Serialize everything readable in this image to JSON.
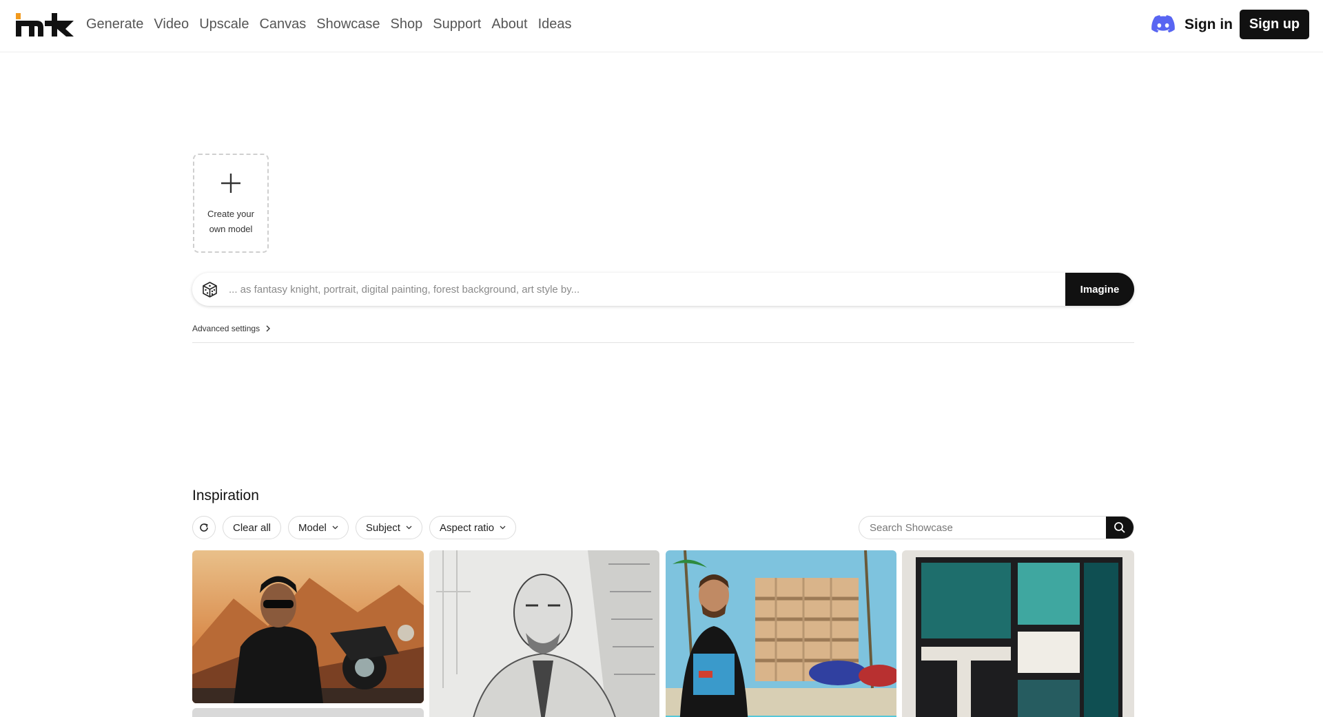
{
  "header": {
    "logo_alt": "mk",
    "nav": [
      "Generate",
      "Video",
      "Upscale",
      "Canvas",
      "Showcase",
      "Shop",
      "Support",
      "About",
      "Ideas"
    ],
    "discord_icon": "discord-icon",
    "sign_in": "Sign in",
    "sign_up": "Sign up"
  },
  "create_model": {
    "line1": "Create your",
    "line2": "own model",
    "icon": "plus-icon"
  },
  "prompt": {
    "placeholder": "... as fantasy knight, portrait, digital painting, forest background, art style by...",
    "value": "",
    "random_icon": "dice-icon",
    "submit": "Imagine"
  },
  "advanced_settings": "Advanced settings",
  "inspiration": {
    "title": "Inspiration",
    "refresh_icon": "refresh-icon",
    "filters": [
      {
        "label": "Clear all",
        "dropdown": false
      },
      {
        "label": "Model",
        "dropdown": true
      },
      {
        "label": "Subject",
        "dropdown": true
      },
      {
        "label": "Aspect ratio",
        "dropdown": true
      }
    ],
    "search_placeholder": "Search Showcase",
    "search_icon": "search-icon",
    "gallery": [
      {
        "subject": "man in leather jacket and sunglasses with motorcycle in desert"
      },
      {
        "subject": "pencil sketch of bald bearded man in suit"
      },
      {
        "subject": "man in graphic t-shirt in front of tropical apartment building"
      },
      {
        "subject": "abstract teal and black geometric painting on canvas"
      }
    ]
  },
  "colors": {
    "accent": "#111111",
    "logo_orange": "#f29a1e",
    "discord": "#5865f2"
  }
}
